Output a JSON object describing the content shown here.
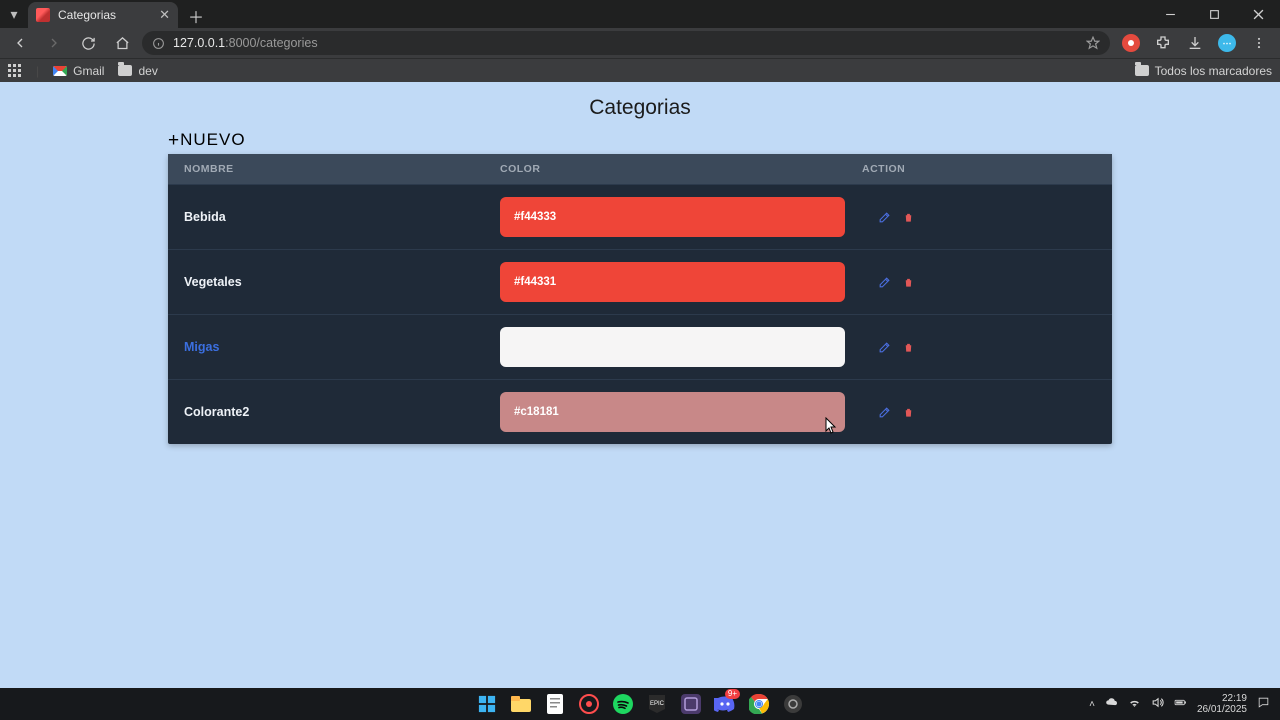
{
  "browser": {
    "tab_title": "Categorias",
    "url_host": "127.0.0.1",
    "url_port": ":8000",
    "url_path": "/categories",
    "bookmarks": {
      "gmail": "Gmail",
      "dev": "dev",
      "all": "Todos los marcadores"
    }
  },
  "page": {
    "title": "Categorias",
    "add_label": "NUEVO",
    "headers": {
      "name": "NOMBRE",
      "color": "COLOR",
      "action": "ACTION"
    },
    "rows": [
      {
        "name": "Bebida",
        "hex": "#f44333",
        "swatch": "#ef4538",
        "text": "#ffffff"
      },
      {
        "name": "Vegetales",
        "hex": "#f44331",
        "swatch": "#ef4538",
        "text": "#ffffff"
      },
      {
        "name": "Migas",
        "hex": "#ffffff",
        "swatch": "#f6f5f5",
        "text": "#f6f5f5"
      },
      {
        "name": "Colorante2",
        "hex": "#c18181",
        "swatch": "#c88888",
        "text": "#ffffff"
      }
    ],
    "selected_row_index": 2
  },
  "system": {
    "time": "22:19",
    "date": "26/01/2025"
  }
}
